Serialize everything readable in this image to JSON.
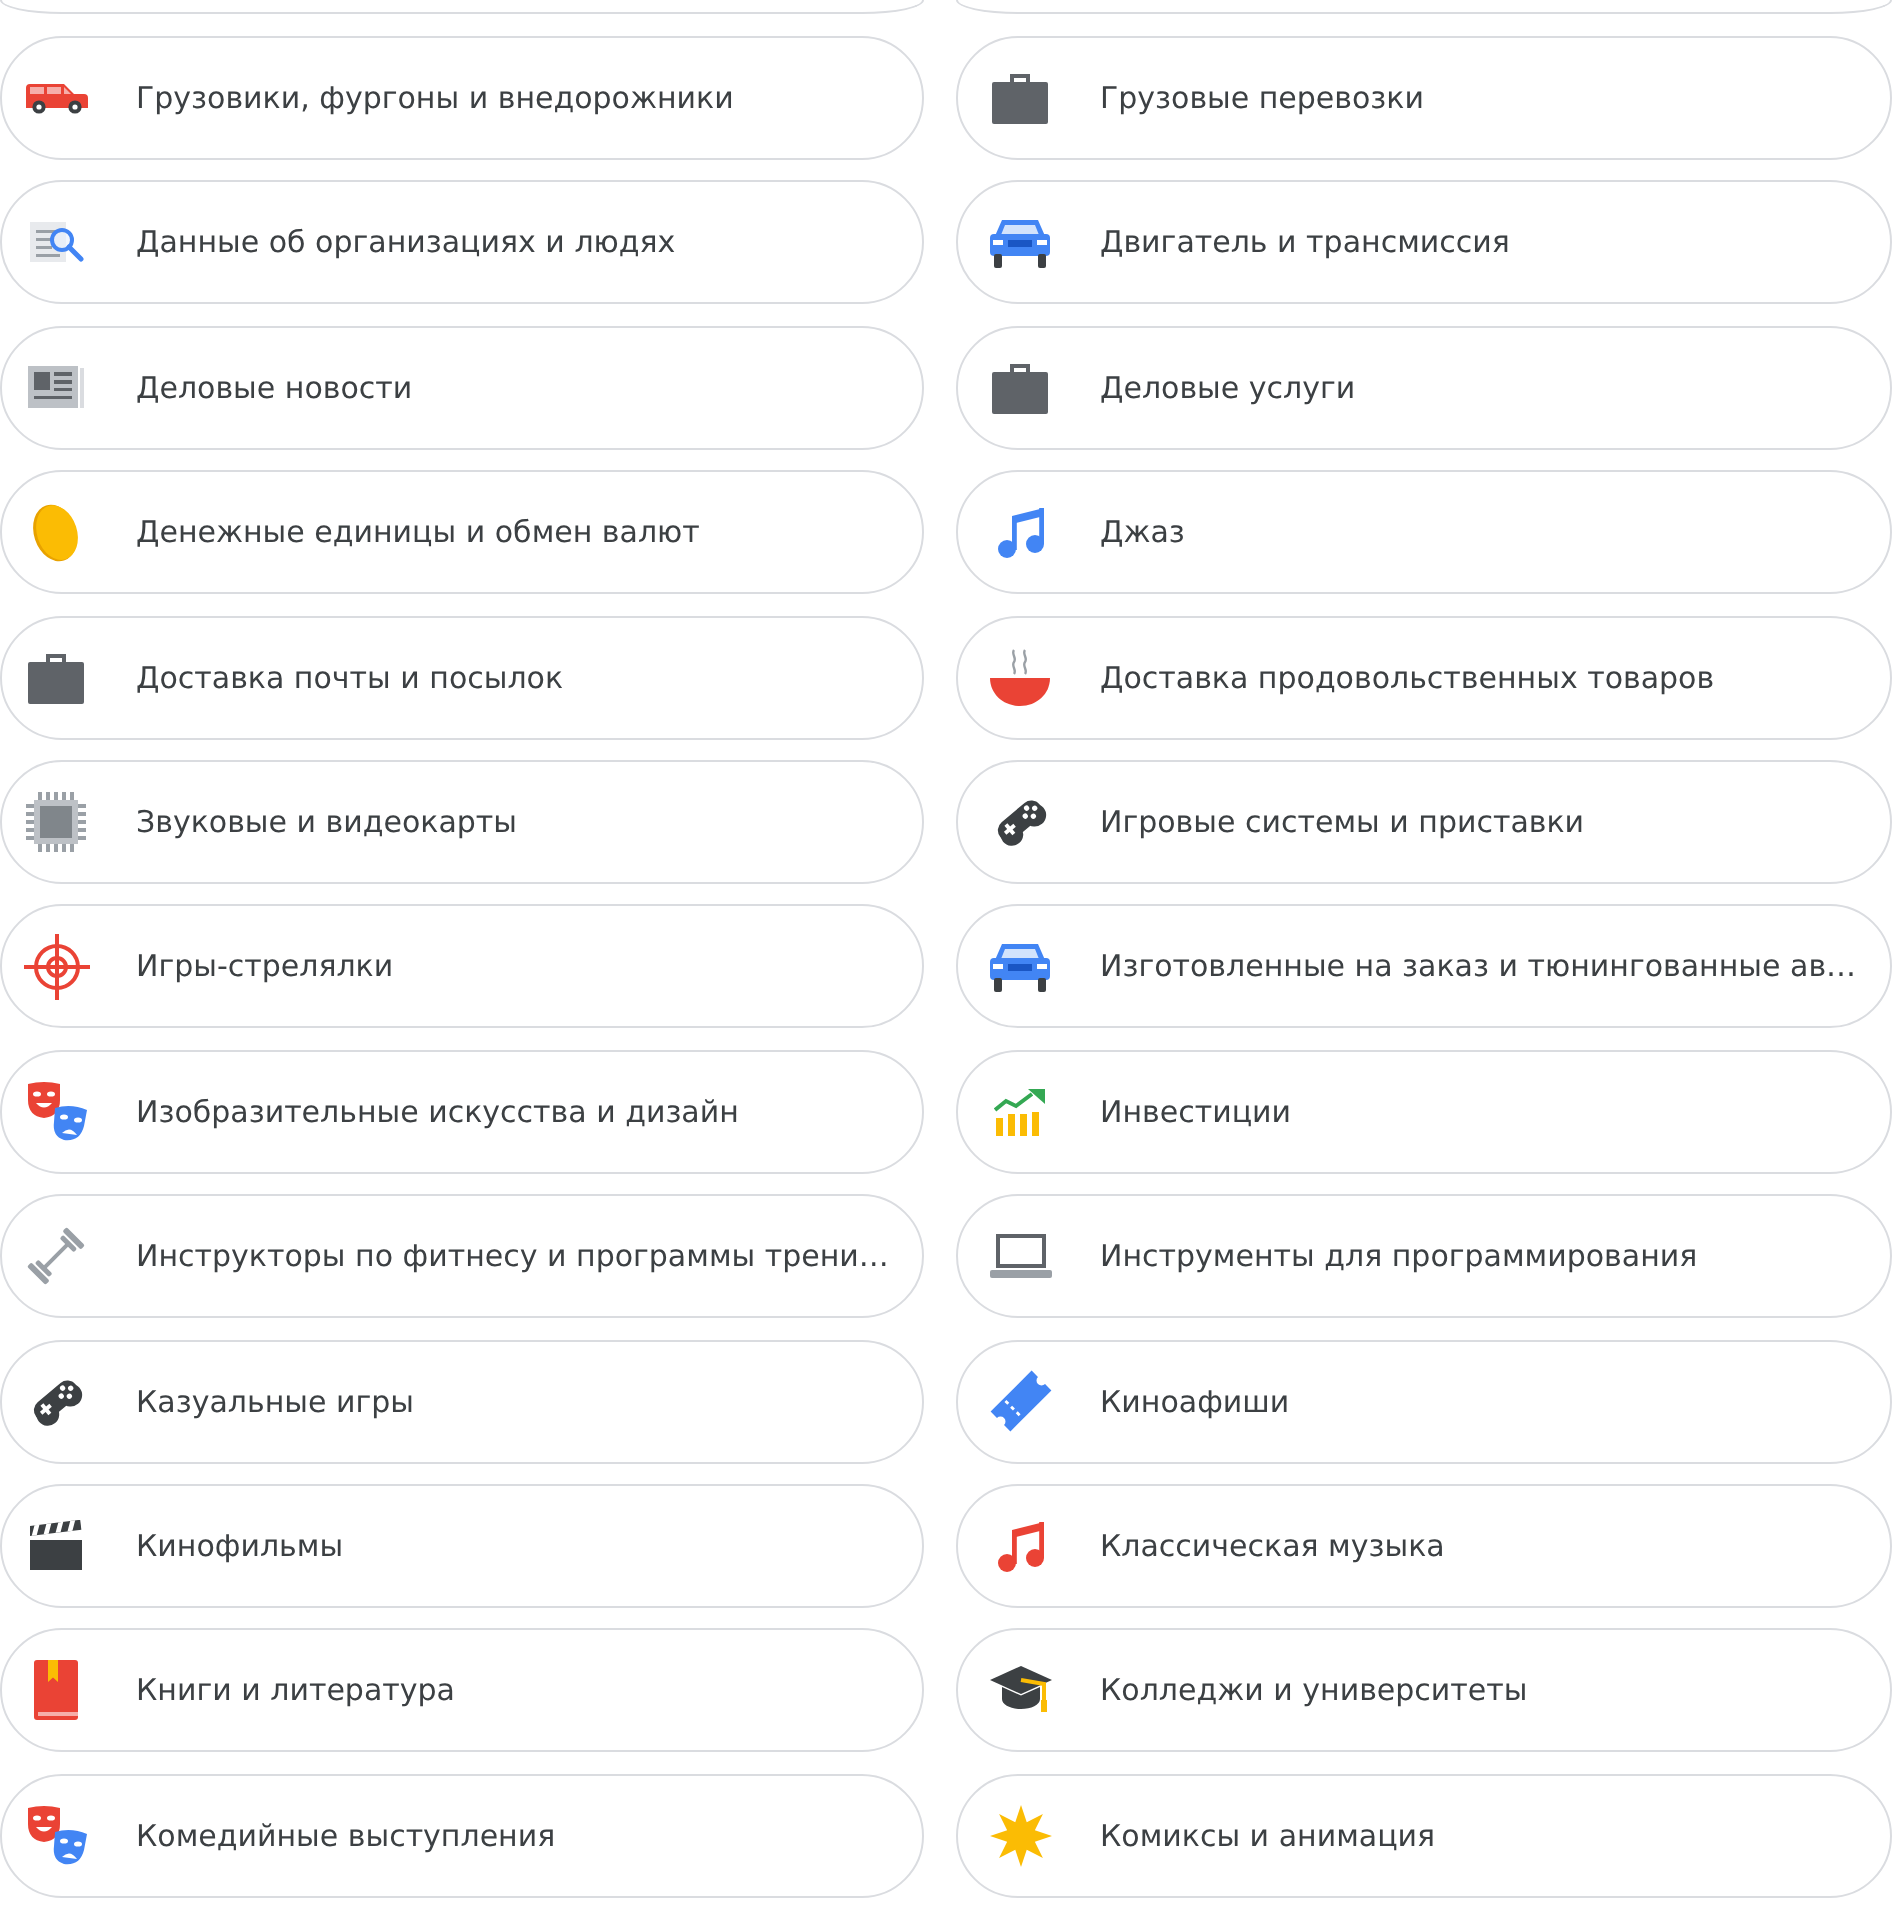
{
  "categories": [
    {
      "label": "Грузовики, фургоны и внедорожники"
    },
    {
      "label": "Грузовые перевозки"
    },
    {
      "label": "Данные об организациях и людях"
    },
    {
      "label": "Двигатель и трансмиссия"
    },
    {
      "label": "Деловые новости"
    },
    {
      "label": "Деловые услуги"
    },
    {
      "label": "Денежные единицы и обмен валют"
    },
    {
      "label": "Джаз"
    },
    {
      "label": "Доставка почты и посылок"
    },
    {
      "label": "Доставка продовольственных товаров"
    },
    {
      "label": "Звуковые и видеокарты"
    },
    {
      "label": "Игровые системы и приставки"
    },
    {
      "label": "Игры-стрелялки"
    },
    {
      "label": "Изготовленные на заказ и тюнингованные ав…"
    },
    {
      "label": "Изобразительные искусства и дизайн"
    },
    {
      "label": "Инвестиции"
    },
    {
      "label": "Инструкторы по фитнесу и программы трени…"
    },
    {
      "label": "Инструменты для программирования"
    },
    {
      "label": "Казуальные игры"
    },
    {
      "label": "Киноафиши"
    },
    {
      "label": "Кинофильмы"
    },
    {
      "label": "Классическая музыка"
    },
    {
      "label": "Книги и литература"
    },
    {
      "label": "Колледжи и университеты"
    },
    {
      "label": "Комедийные выступления"
    },
    {
      "label": "Комиксы и анимация"
    }
  ]
}
